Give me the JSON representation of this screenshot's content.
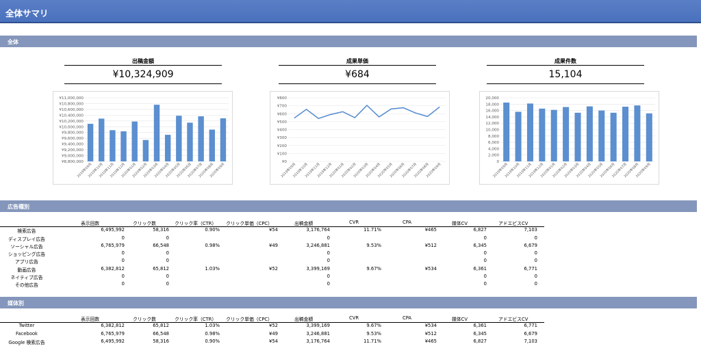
{
  "header": {
    "title": "全体サマリ"
  },
  "sections": {
    "overall": "全体",
    "ad_type": "広告種別",
    "media": "媒体別"
  },
  "kpis": [
    {
      "label": "出稿金額",
      "value": "¥10,324,909"
    },
    {
      "label": "成果単価",
      "value": "¥684"
    },
    {
      "label": "成果件数",
      "value": "15,104"
    }
  ],
  "chart_data": [
    {
      "type": "bar",
      "categories": [
        "2019年09月",
        "2019年10月",
        "2019年11月",
        "2019年12月",
        "2020年01月",
        "2020年02月",
        "2020年03月",
        "2020年04月",
        "2020年05月",
        "2020年06月",
        "2020年07月",
        "2020年08月",
        "2020年09月"
      ],
      "values": [
        10100000,
        10280000,
        9880000,
        9840000,
        10180000,
        9540000,
        10760000,
        9720000,
        10380000,
        10140000,
        10360000,
        9900000,
        10290000
      ],
      "yticks": [
        "¥8,800,000",
        "¥9,000,000",
        "¥9,200,000",
        "¥9,400,000",
        "¥9,600,000",
        "¥9,800,000",
        "¥10,000,000",
        "¥10,200,000",
        "¥10,400,000",
        "¥10,600,000",
        "¥10,800,000",
        "¥11,000,000"
      ],
      "ylim": [
        8800000,
        11000000
      ],
      "color": "#5b8fd0"
    },
    {
      "type": "line",
      "categories": [
        "2019年09月",
        "2019年10月",
        "2019年11月",
        "2019年12月",
        "2020年01月",
        "2020年02月",
        "2020年03月",
        "2020年04月",
        "2020年05月",
        "2020年06月",
        "2020年07月",
        "2020年08月",
        "2020年09月"
      ],
      "values": [
        545,
        655,
        540,
        590,
        625,
        550,
        705,
        560,
        660,
        675,
        610,
        565,
        685
      ],
      "yticks": [
        "¥0",
        "¥100",
        "¥200",
        "¥300",
        "¥400",
        "¥500",
        "¥600",
        "¥700",
        "¥800"
      ],
      "ylim": [
        0,
        800
      ],
      "color": "#5b8fd0"
    },
    {
      "type": "bar",
      "categories": [
        "2019年09月",
        "2019年10月",
        "2019年11月",
        "2019年12月",
        "2020年01月",
        "2020年02月",
        "2020年03月",
        "2020年04月",
        "2020年05月",
        "2020年06月",
        "2020年07月",
        "2020年08月",
        "2020年09月"
      ],
      "values": [
        18500,
        15600,
        18200,
        16600,
        16200,
        17100,
        15300,
        17300,
        16000,
        15300,
        17200,
        17600,
        15100
      ],
      "yticks": [
        "0",
        "2,000",
        "4,000",
        "6,000",
        "8,000",
        "10,000",
        "12,000",
        "14,000",
        "16,000",
        "18,000",
        "20,000"
      ],
      "ylim": [
        0,
        20000
      ],
      "color": "#5b8fd0"
    }
  ],
  "columns": [
    "表示回数",
    "クリック数",
    "クリック率（CTR）",
    "クリック単価（CPC）",
    "出稿金額",
    "CVR",
    "CPA",
    "媒体CV",
    "アドエビスCV"
  ],
  "ad_type_rows": [
    {
      "name": "検索広告",
      "cells": [
        "6,495,992",
        "58,316",
        "0.90%",
        "¥54",
        "3,176,764",
        "11.71%",
        "¥465",
        "6,827",
        "7,103"
      ]
    },
    {
      "name": "ディスプレイ広告",
      "cells": [
        "0",
        "0",
        "",
        "",
        "0",
        "",
        "",
        "0",
        "0"
      ]
    },
    {
      "name": "ソーシャル広告",
      "cells": [
        "6,765,979",
        "66,548",
        "0.98%",
        "¥49",
        "3,246,881",
        "9.53%",
        "¥512",
        "6,345",
        "6,679"
      ]
    },
    {
      "name": "ショッピング広告",
      "cells": [
        "0",
        "0",
        "",
        "",
        "0",
        "",
        "",
        "0",
        "0"
      ]
    },
    {
      "name": "アプリ広告",
      "cells": [
        "0",
        "0",
        "",
        "",
        "0",
        "",
        "",
        "0",
        "0"
      ]
    },
    {
      "name": "動画広告",
      "cells": [
        "6,382,812",
        "65,812",
        "1.03%",
        "¥52",
        "3,399,169",
        "9.67%",
        "¥534",
        "6,361",
        "6,771"
      ]
    },
    {
      "name": "ネイティブ広告",
      "cells": [
        "0",
        "0",
        "",
        "",
        "0",
        "",
        "",
        "0",
        "0"
      ]
    },
    {
      "name": "その他広告",
      "cells": [
        "0",
        "0",
        "",
        "",
        "0",
        "",
        "",
        "0",
        "0"
      ]
    }
  ],
  "media_rows": [
    {
      "name": "Twitter",
      "cells": [
        "6,382,812",
        "65,812",
        "1.03%",
        "¥52",
        "3,399,169",
        "9.67%",
        "¥534",
        "6,361",
        "6,771"
      ]
    },
    {
      "name": "Facebook",
      "cells": [
        "6,765,979",
        "66,548",
        "0.98%",
        "¥49",
        "3,246,881",
        "9.53%",
        "¥512",
        "6,345",
        "6,679"
      ]
    },
    {
      "name": "Google 検索広告",
      "cells": [
        "6,495,992",
        "58,316",
        "0.90%",
        "¥54",
        "3,176,764",
        "11.71%",
        "¥465",
        "6,827",
        "7,103"
      ]
    }
  ]
}
